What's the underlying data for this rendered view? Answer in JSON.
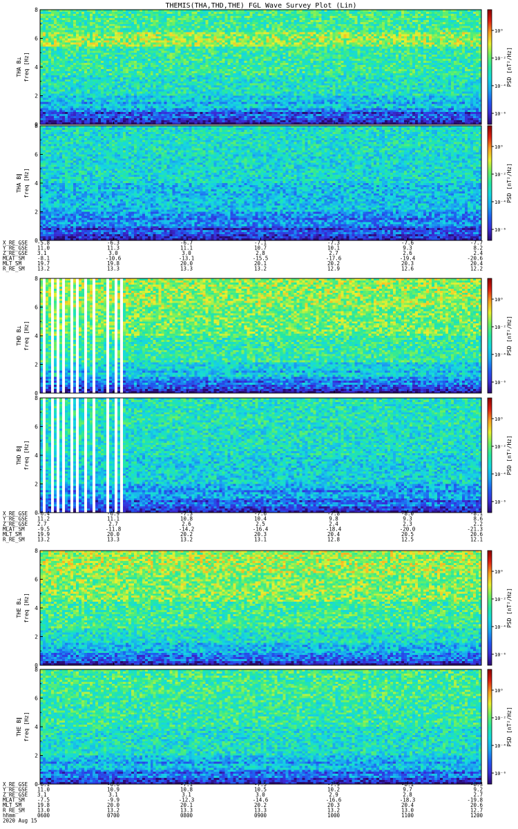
{
  "title": "THEMIS(THA,THD,THE) FGL Wave Survey Plot (Lin)",
  "colorbar_gradient": [
    "#2a0a6e",
    "#3a2bd6",
    "#1f5cf0",
    "#1aa6f0",
    "#15d8e0",
    "#25e8a0",
    "#6ff060",
    "#e8f030",
    "#f8a020",
    "#e02010",
    "#8a0000"
  ],
  "chart_data": [
    {
      "type": "heatmap",
      "probe": "THA",
      "component": "perp",
      "ylabel": "THA B⊥\nfreq [Hz]",
      "ylim": [
        0,
        8
      ],
      "yticks": [
        "0",
        "2",
        "4",
        "6",
        "8"
      ],
      "zlabel": "PSD [nT²/Hz]",
      "zscale": "log",
      "zticks": [
        "10⁰",
        "10⁻²",
        "10⁻⁴",
        "10⁻⁶"
      ],
      "bands": [
        {
          "lo": 0,
          "hi": 0.25,
          "v": 0.1
        },
        {
          "lo": 0.25,
          "hi": 0.5,
          "v": 0.15
        },
        {
          "lo": 0.5,
          "hi": 0.8,
          "v": 0.2
        },
        {
          "lo": 0.8,
          "hi": 1.2,
          "v": 0.28
        },
        {
          "lo": 1.2,
          "hi": 2.0,
          "v": 0.38
        },
        {
          "lo": 2.0,
          "hi": 3.5,
          "v": 0.45
        },
        {
          "lo": 3.5,
          "hi": 5.4,
          "v": 0.5
        },
        {
          "lo": 5.4,
          "hi": 6.4,
          "v": 0.62
        },
        {
          "lo": 6.4,
          "hi": 8,
          "v": 0.52
        }
      ],
      "gaps": []
    },
    {
      "type": "heatmap",
      "probe": "THA",
      "component": "par",
      "ylabel": "THA B∥\nfreq [Hz]",
      "ylim": [
        0,
        8
      ],
      "yticks": [
        "0",
        "2",
        "4",
        "6",
        "8"
      ],
      "zlabel": "PSD [nT²/Hz]",
      "zscale": "log",
      "zticks": [
        "10⁰",
        "10⁻²",
        "10⁻⁴",
        "10⁻⁶"
      ],
      "bands": [
        {
          "lo": 0,
          "hi": 0.4,
          "v": 0.12
        },
        {
          "lo": 0.4,
          "hi": 1.0,
          "v": 0.2
        },
        {
          "lo": 1.0,
          "hi": 2.0,
          "v": 0.28
        },
        {
          "lo": 2.0,
          "hi": 4.0,
          "v": 0.36
        },
        {
          "lo": 4.0,
          "hi": 6.0,
          "v": 0.42
        },
        {
          "lo": 6.0,
          "hi": 8,
          "v": 0.44
        }
      ],
      "gaps": []
    },
    {
      "type": "heatmap",
      "probe": "THD",
      "component": "perp",
      "ylabel": "THD B⊥\nfreq [Hz]",
      "ylim": [
        0,
        8
      ],
      "yticks": [
        "0",
        "2",
        "4",
        "6",
        "8"
      ],
      "zlabel": "PSD [nT²/Hz]",
      "zscale": "log",
      "zticks": [
        "10⁰",
        "10⁻²",
        "10⁻⁴",
        "10⁻⁶"
      ],
      "bands": [
        {
          "lo": 0,
          "hi": 0.25,
          "v": 0.1
        },
        {
          "lo": 0.25,
          "hi": 0.6,
          "v": 0.18
        },
        {
          "lo": 0.6,
          "hi": 1.2,
          "v": 0.28
        },
        {
          "lo": 1.2,
          "hi": 2.2,
          "v": 0.4
        },
        {
          "lo": 2.2,
          "hi": 4.0,
          "v": 0.5
        },
        {
          "lo": 4.0,
          "hi": 6.0,
          "v": 0.58
        },
        {
          "lo": 6.0,
          "hi": 8,
          "v": 0.62
        }
      ],
      "gaps": [
        [
          0.005,
          0.012
        ],
        [
          0.02,
          0.028
        ],
        [
          0.036,
          0.042
        ],
        [
          0.05,
          0.056
        ],
        [
          0.064,
          0.07
        ],
        [
          0.078,
          0.085
        ],
        [
          0.096,
          0.104
        ],
        [
          0.118,
          0.124
        ],
        [
          0.144,
          0.152
        ],
        [
          0.168,
          0.174
        ],
        [
          0.18,
          0.186
        ]
      ]
    },
    {
      "type": "heatmap",
      "probe": "THD",
      "component": "par",
      "ylabel": "THD B∥\nfreq [Hz]",
      "ylim": [
        0,
        8
      ],
      "yticks": [
        "0",
        "2",
        "4",
        "6",
        "8"
      ],
      "zlabel": "PSD [nT²/Hz]",
      "zscale": "log",
      "zticks": [
        "10⁰",
        "10⁻²",
        "10⁻⁴",
        "10⁻⁶"
      ],
      "bands": [
        {
          "lo": 0,
          "hi": 0.4,
          "v": 0.14
        },
        {
          "lo": 0.4,
          "hi": 1.0,
          "v": 0.24
        },
        {
          "lo": 1.0,
          "hi": 2.0,
          "v": 0.32
        },
        {
          "lo": 2.0,
          "hi": 4.0,
          "v": 0.4
        },
        {
          "lo": 4.0,
          "hi": 6.0,
          "v": 0.44
        },
        {
          "lo": 6.0,
          "hi": 8,
          "v": 0.46
        }
      ],
      "gaps": [
        [
          0.005,
          0.012
        ],
        [
          0.02,
          0.028
        ],
        [
          0.036,
          0.042
        ],
        [
          0.05,
          0.056
        ],
        [
          0.064,
          0.07
        ],
        [
          0.078,
          0.085
        ],
        [
          0.096,
          0.104
        ],
        [
          0.118,
          0.124
        ],
        [
          0.144,
          0.152
        ],
        [
          0.168,
          0.174
        ],
        [
          0.18,
          0.186
        ]
      ]
    },
    {
      "type": "heatmap",
      "probe": "THE",
      "component": "perp",
      "ylabel": "THE B⊥\nfreq [Hz]",
      "ylim": [
        0,
        8
      ],
      "yticks": [
        "0",
        "2",
        "4",
        "6",
        "8"
      ],
      "zlabel": "PSD [nT²/Hz]",
      "zscale": "log",
      "zticks": [
        "10⁰",
        "10⁻²",
        "10⁻⁴",
        "10⁻⁶"
      ],
      "bands": [
        {
          "lo": 0,
          "hi": 0.3,
          "v": 0.12
        },
        {
          "lo": 0.3,
          "hi": 0.7,
          "v": 0.22
        },
        {
          "lo": 0.7,
          "hi": 1.4,
          "v": 0.34
        },
        {
          "lo": 1.4,
          "hi": 2.6,
          "v": 0.44
        },
        {
          "lo": 2.6,
          "hi": 4.5,
          "v": 0.52
        },
        {
          "lo": 4.5,
          "hi": 6.5,
          "v": 0.6
        },
        {
          "lo": 6.5,
          "hi": 8,
          "v": 0.64
        }
      ],
      "gaps": []
    },
    {
      "type": "heatmap",
      "probe": "THE",
      "component": "par",
      "ylabel": "THE B∥\nfreq [Hz]",
      "ylim": [
        0,
        8
      ],
      "yticks": [
        "0",
        "2",
        "4",
        "6",
        "8"
      ],
      "zlabel": "PSD [nT²/Hz]",
      "zscale": "log",
      "zticks": [
        "10⁰",
        "10⁻²",
        "10⁻⁴",
        "10⁻⁶"
      ],
      "bands": [
        {
          "lo": 0,
          "hi": 0.4,
          "v": 0.14
        },
        {
          "lo": 0.4,
          "hi": 1.0,
          "v": 0.26
        },
        {
          "lo": 1.0,
          "hi": 2.0,
          "v": 0.36
        },
        {
          "lo": 2.0,
          "hi": 4.0,
          "v": 0.44
        },
        {
          "lo": 4.0,
          "hi": 6.0,
          "v": 0.5
        },
        {
          "lo": 6.0,
          "hi": 8,
          "v": 0.52
        }
      ],
      "gaps": []
    }
  ],
  "ephemeris": [
    {
      "labels": [
        "X_RE_GSE",
        "Y_RE_GSE",
        "Z_RE_GSE",
        "MLAT_SM",
        "MLT_SM",
        "R_RE_SM"
      ],
      "rows": [
        [
          "-5.8",
          "-6.3",
          "-6.7",
          "-7.1",
          "-7.3",
          "-7.6",
          "-7.7"
        ],
        [
          "11.0",
          "11.3",
          "11.1",
          "10.7",
          "10.1",
          "9.3",
          "8.2"
        ],
        [
          "3.1",
          "3.0",
          "3.0",
          "2.8",
          "2.7",
          "2.6",
          "2.4"
        ],
        [
          "-8.1",
          "-10.6",
          "-13.1",
          "-15.5",
          "-17.6",
          "-19.4",
          "-20.6"
        ],
        [
          "19.7",
          "19.8",
          "20.0",
          "20.1",
          "20.2",
          "20.3",
          "20.4"
        ],
        [
          "13.2",
          "13.3",
          "13.3",
          "13.2",
          "12.9",
          "12.6",
          "12.2"
        ]
      ]
    },
    {
      "labels": [
        "X_RE_GSE",
        "Y_RE_GSE",
        "Z_RE_GSE",
        "MLAT_SM",
        "MLT_SM",
        "R_RE_SM"
      ],
      "rows": [
        [
          "-6.4",
          "-6.9",
          "-7.3",
          "-7.6",
          "-7.8",
          "-8.0",
          "-8.1"
        ],
        [
          "11.2",
          "11.1",
          "10.8",
          "10.4",
          "9.8",
          "9.3",
          "8.6"
        ],
        [
          "2.7",
          "2.7",
          "2.6",
          "2.5",
          "2.4",
          "2.3",
          "2.2"
        ],
        [
          "-9.5",
          "-11.8",
          "-14.2",
          "-16.4",
          "-18.4",
          "-20.0",
          "-21.3"
        ],
        [
          "19.9",
          "20.0",
          "20.2",
          "20.3",
          "20.4",
          "20.5",
          "20.6"
        ],
        [
          "13.2",
          "13.3",
          "13.2",
          "13.1",
          "12.8",
          "12.5",
          "12.1"
        ]
      ]
    },
    {
      "labels": [
        "X_RE_GSE",
        "Y_RE_GSE",
        "Z_RE_GSE",
        "MLAT_SM",
        "MLT_SM",
        "R_RE_SM",
        "hhmm"
      ],
      "rows": [
        [
          "-6.1",
          "-6.6",
          "-7.1",
          "-7.5",
          "-7.9",
          "-8.1",
          "-8.3"
        ],
        [
          "11.0",
          "10.9",
          "10.8",
          "10.5",
          "10.2",
          "9.7",
          "9.2"
        ],
        [
          "3.1",
          "3.1",
          "3.1",
          "3.0",
          "2.9",
          "2.8",
          "2.7"
        ],
        [
          "-7.5",
          "-9.9",
          "-12.3",
          "-14.6",
          "-16.6",
          "-18.3",
          "-19.8"
        ],
        [
          "19.8",
          "20.0",
          "20.1",
          "20.2",
          "20.3",
          "20.4",
          "20.6"
        ],
        [
          "13.0",
          "13.2",
          "13.3",
          "13.3",
          "13.2",
          "13.0",
          "12.7"
        ],
        [
          "0600",
          "0700",
          "0800",
          "0900",
          "1000",
          "1100",
          "1200"
        ]
      ],
      "date": "2020 Aug 15"
    }
  ]
}
